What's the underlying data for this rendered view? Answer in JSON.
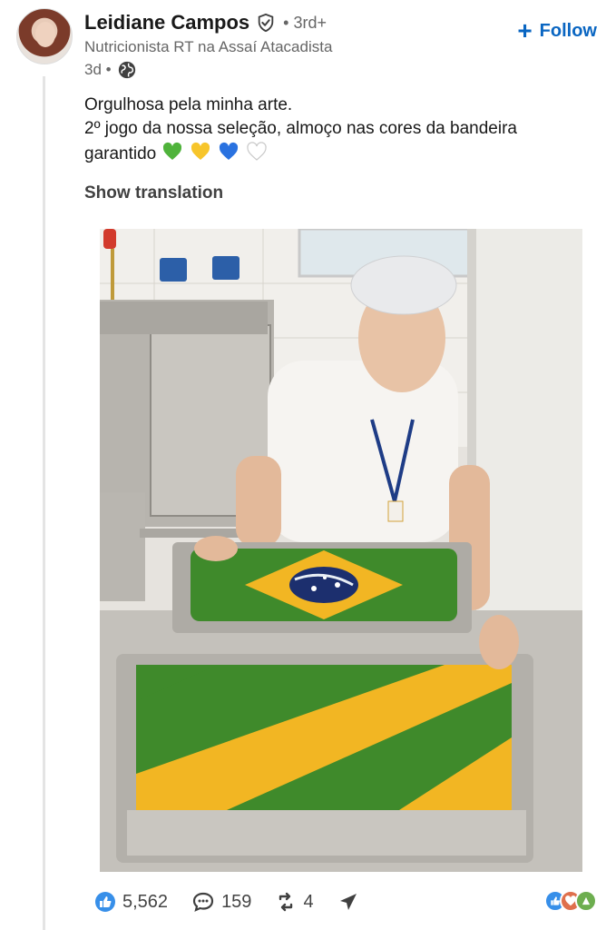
{
  "author": {
    "name": "Leidiane Campos",
    "degree": "• 3rd+",
    "headline": "Nutricionista RT na Assaí Atacadista",
    "time": "3d •"
  },
  "follow_label": "Follow",
  "post": {
    "line1": "Orgulhosa pela minha arte.",
    "line2": "2º jogo da nossa seleção, almoço nas cores da bandeira",
    "line3": "garantido",
    "emojis": [
      "green-heart-icon",
      "yellow-heart-icon",
      "blue-heart-icon",
      "white-heart-icon"
    ]
  },
  "show_translation": "Show translation",
  "stats": {
    "reactions": "5,562",
    "comments": "159",
    "reposts": "4"
  },
  "colors": {
    "accent": "#0a66c2",
    "muted": "#666666",
    "green": "#3f8a2b",
    "yellow": "#f2b623",
    "blue": "#1c3a8a"
  }
}
